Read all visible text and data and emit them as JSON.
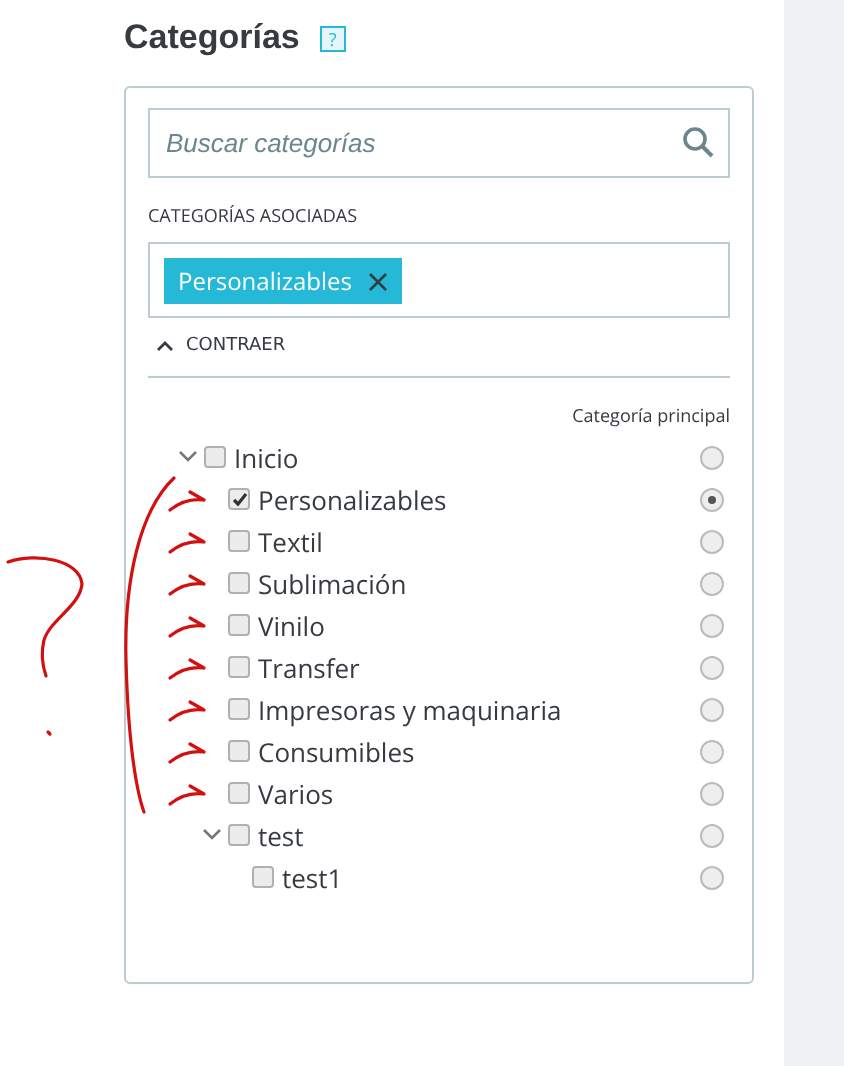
{
  "title": "Categorías",
  "help": "?",
  "search": {
    "placeholder": "Buscar categorías"
  },
  "associated_label": "CATEGORÍAS ASOCIADAS",
  "tags": [
    {
      "label": "Personalizables"
    }
  ],
  "collapse": {
    "label": "CONTRAER",
    "expanded": true
  },
  "tree_header": "Categoría principal",
  "tree": [
    {
      "label": "Inicio",
      "checked": false,
      "selected": false,
      "expanded": true,
      "children": [
        {
          "label": "Personalizables",
          "checked": true,
          "selected": true
        },
        {
          "label": "Textil",
          "checked": false,
          "selected": false
        },
        {
          "label": "Sublimación",
          "checked": false,
          "selected": false
        },
        {
          "label": "Vinilo",
          "checked": false,
          "selected": false
        },
        {
          "label": "Transfer",
          "checked": false,
          "selected": false
        },
        {
          "label": "Impresoras y maquinaria",
          "checked": false,
          "selected": false
        },
        {
          "label": "Consumibles",
          "checked": false,
          "selected": false
        },
        {
          "label": "Varios",
          "checked": false,
          "selected": false
        },
        {
          "label": "test",
          "checked": false,
          "selected": false,
          "expanded": true,
          "children": [
            {
              "label": "test1",
              "checked": false,
              "selected": false
            }
          ]
        }
      ]
    }
  ]
}
